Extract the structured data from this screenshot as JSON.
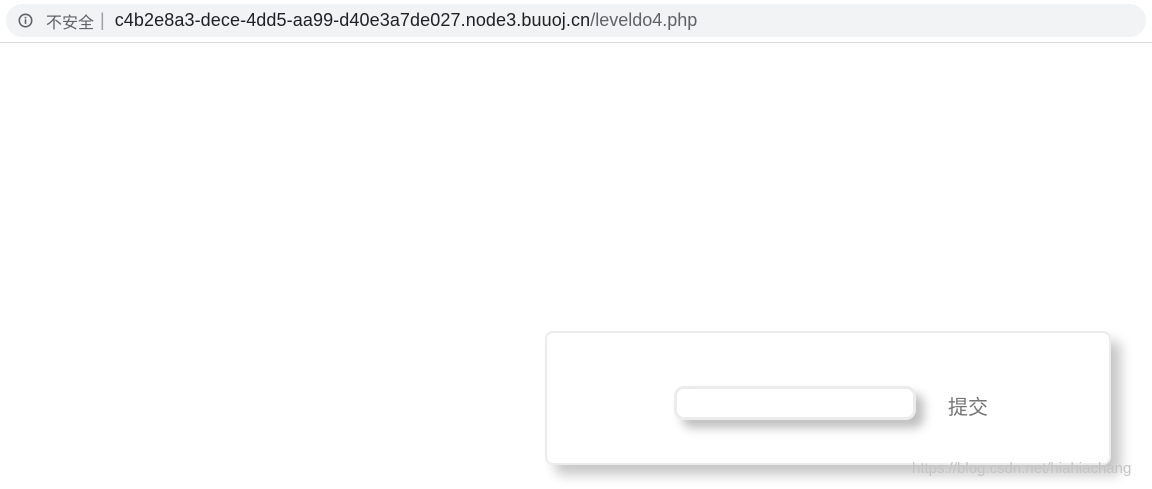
{
  "address_bar": {
    "security_label": "不安全",
    "divider": "|",
    "url_host": "c4b2e8a3-dece-4dd5-aa99-d40e3a7de027.node3.buuoj.cn",
    "url_path": "/leveldo4.php"
  },
  "form": {
    "input_value": "",
    "submit_label": "提交"
  },
  "watermark": "https://blog.csdn.net/hiahiachang",
  "colors": {
    "omnibox_bg": "#f1f3f4",
    "card_border": "#ececec",
    "button_text": "#757575"
  },
  "icons": {
    "info": "info-circle-icon"
  }
}
